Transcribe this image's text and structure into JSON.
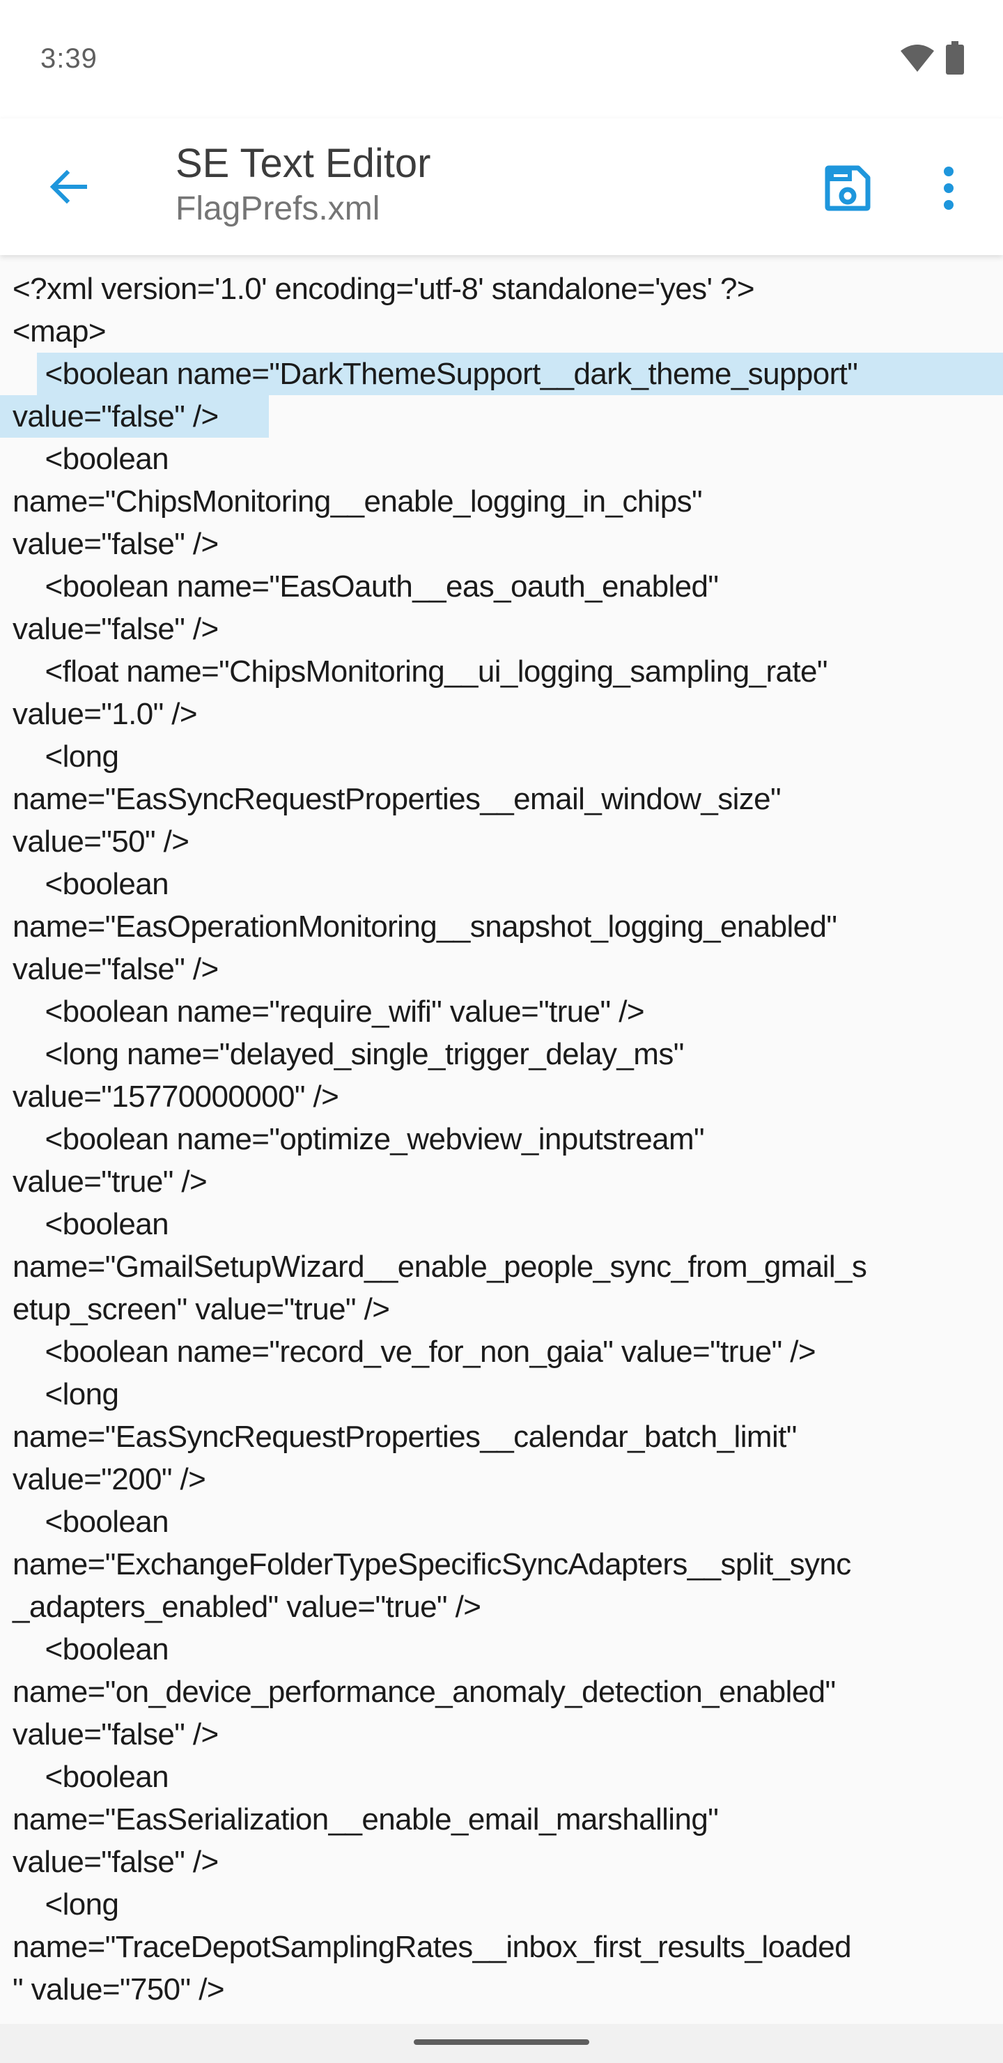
{
  "status_bar": {
    "time": "3:39",
    "icons": [
      "wifi-icon",
      "battery-icon"
    ]
  },
  "app_bar": {
    "title": "SE Text Editor",
    "subtitle": "FlagPrefs.xml",
    "back_icon": "arrow-back-icon",
    "save_icon": "save-icon",
    "more_icon": "more-vert-icon",
    "accent_color": "#1E96DC"
  },
  "editor": {
    "selection_color": "#CCE7F6",
    "selected_text": "<boolean name=\"DarkThemeSupport__dark_theme_support\" value=\"false\" />",
    "lines": [
      "<?xml version='1.0' encoding='utf-8' standalone='yes' ?>",
      "<map>",
      "    <boolean name=\"DarkThemeSupport__dark_theme_support\"",
      "value=\"false\" />",
      "    <boolean",
      "name=\"ChipsMonitoring__enable_logging_in_chips\"",
      "value=\"false\" />",
      "    <boolean name=\"EasOauth__eas_oauth_enabled\"",
      "value=\"false\" />",
      "    <float name=\"ChipsMonitoring__ui_logging_sampling_rate\"",
      "value=\"1.0\" />",
      "    <long",
      "name=\"EasSyncRequestProperties__email_window_size\"",
      "value=\"50\" />",
      "    <boolean",
      "name=\"EasOperationMonitoring__snapshot_logging_enabled\"",
      "value=\"false\" />",
      "    <boolean name=\"require_wifi\" value=\"true\" />",
      "    <long name=\"delayed_single_trigger_delay_ms\"",
      "value=\"15770000000\" />",
      "    <boolean name=\"optimize_webview_inputstream\"",
      "value=\"true\" />",
      "    <boolean",
      "name=\"GmailSetupWizard__enable_people_sync_from_gmail_s",
      "etup_screen\" value=\"true\" />",
      "    <boolean name=\"record_ve_for_non_gaia\" value=\"true\" />",
      "    <long",
      "name=\"EasSyncRequestProperties__calendar_batch_limit\"",
      "value=\"200\" />",
      "    <boolean",
      "name=\"ExchangeFolderTypeSpecificSyncAdapters__split_sync",
      "_adapters_enabled\" value=\"true\" />",
      "    <boolean",
      "name=\"on_device_performance_anomaly_detection_enabled\"",
      "value=\"false\" />",
      "    <boolean",
      "name=\"EasSerialization__enable_email_marshalling\"",
      "value=\"false\" />",
      "    <long",
      "name=\"TraceDepotSamplingRates__inbox_first_results_loaded",
      "\" value=\"750\" />"
    ]
  },
  "nav_bar": {
    "handle": "gesture-handle"
  }
}
